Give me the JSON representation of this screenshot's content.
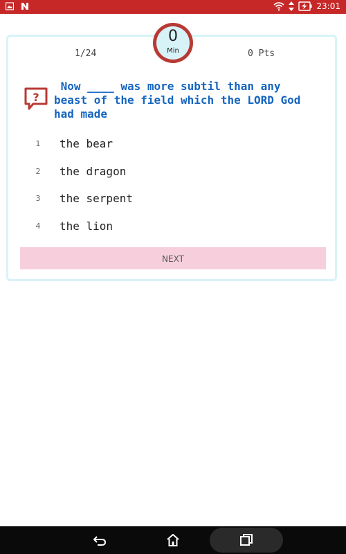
{
  "status_bar": {
    "time": "23:01",
    "icons": [
      "image-icon",
      "n-icon",
      "wifi-icon",
      "signal-icon",
      "battery-charging-icon"
    ]
  },
  "quiz": {
    "timer": {
      "value": "0",
      "unit": "Min"
    },
    "progress": "1/24",
    "points": "0 Pts",
    "question": " Now ____ was more subtil than any\nbeast of the field which the LORD God\nhad made",
    "options": [
      {
        "number": "1",
        "text": "the bear"
      },
      {
        "number": "2",
        "text": "the dragon"
      },
      {
        "number": "3",
        "text": "the serpent"
      },
      {
        "number": "4",
        "text": "the lion"
      }
    ],
    "next_label": "NEXT"
  },
  "nav_bar": {
    "icons": [
      "back-icon",
      "home-icon",
      "recent-apps-icon"
    ]
  },
  "colors": {
    "status_bar": "#c62828",
    "timer_ring": "#b83a34",
    "card_border": "#d7f3f8",
    "question_text": "#1565c0",
    "next_button": "#f7cfdc"
  }
}
